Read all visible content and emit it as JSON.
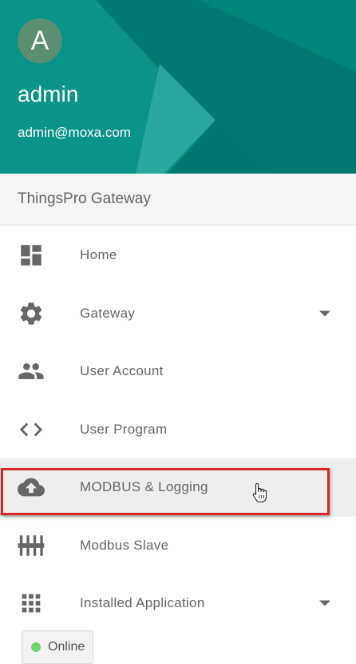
{
  "user": {
    "avatar_initial": "A",
    "name": "admin",
    "email": "admin@moxa.com"
  },
  "subheader": {
    "title": "ThingsPro Gateway"
  },
  "nav": {
    "items": [
      {
        "label": "Home",
        "icon": "dashboard-icon",
        "expandable": false
      },
      {
        "label": "Gateway",
        "icon": "gear-icon",
        "expandable": true
      },
      {
        "label": "User Account",
        "icon": "people-icon",
        "expandable": false
      },
      {
        "label": "User Program",
        "icon": "code-icon",
        "expandable": false
      },
      {
        "label": "MODBUS & Logging",
        "icon": "cloud-upload-icon",
        "expandable": false,
        "hovered": true
      },
      {
        "label": "Modbus Slave",
        "icon": "sliders-icon",
        "expandable": false
      },
      {
        "label": "Installed Application",
        "icon": "apps-grid-icon",
        "expandable": true
      }
    ]
  },
  "status": {
    "label": "Online",
    "color": "#6dd36d"
  },
  "colors": {
    "header_teal": "#00897b",
    "text_gray": "#666666",
    "highlight_red": "#d9262b"
  }
}
